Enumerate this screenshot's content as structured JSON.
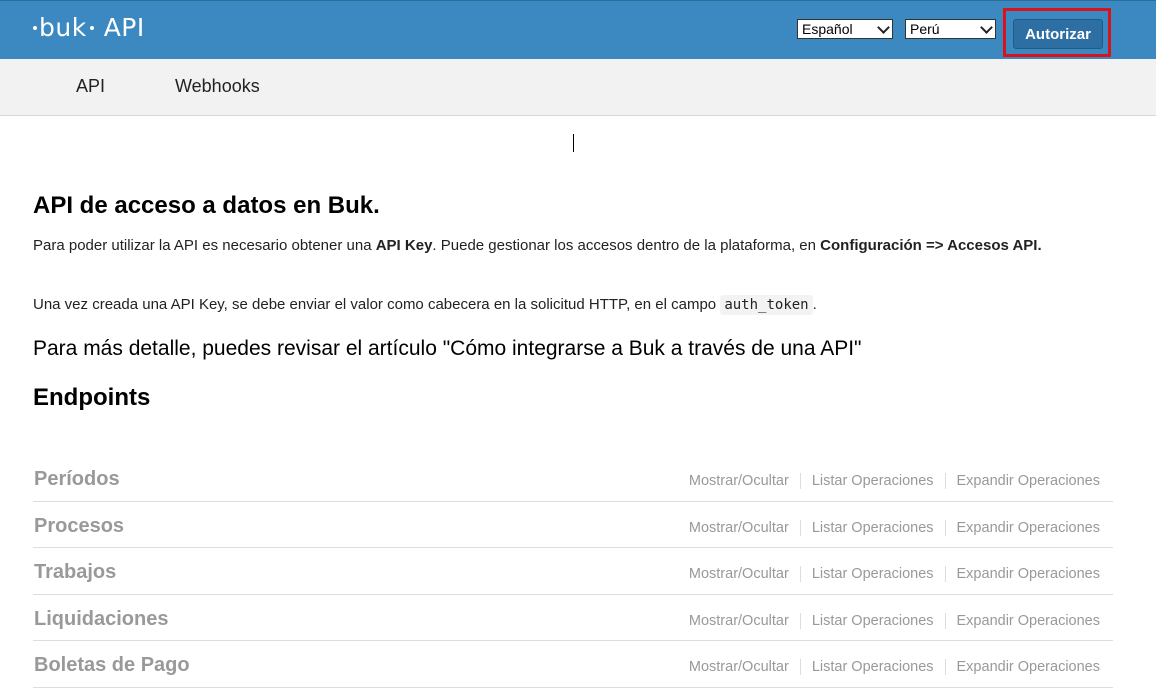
{
  "header": {
    "logo_text": "buk",
    "title": "API",
    "language_select": {
      "selected": "Español"
    },
    "country_select": {
      "selected": "Perú"
    },
    "authorize_label": "Autorizar",
    "highlight_color": "#d9131b",
    "bar_color": "#3b89c0"
  },
  "subnav": {
    "items": [
      {
        "label": "API"
      },
      {
        "label": "Webhooks"
      }
    ]
  },
  "intro": {
    "title": "API de acceso a datos en Buk.",
    "p1_part1": "Para poder utilizar la API es necesario obtener una ",
    "p1_bold1": "API Key",
    "p1_part2": ". Puede gestionar los accesos dentro de la plataforma, en ",
    "p1_bold2": "Configuración => Accesos API.",
    "p2_part1": "Una vez creada una API Key, se debe enviar el valor como cabecera en la solicitud HTTP, en el campo ",
    "p2_code": "auth_token",
    "p2_part2": ".",
    "more_link": "Para más detalle, puedes revisar el artículo \"Cómo integrarse a Buk a través de una API\""
  },
  "endpoints": {
    "title": "Endpoints",
    "actions": {
      "toggle": "Mostrar/Ocultar",
      "list": "Listar Operaciones",
      "expand": "Expandir Operaciones"
    },
    "resources": [
      {
        "name": "Períodos"
      },
      {
        "name": "Procesos"
      },
      {
        "name": "Trabajos"
      },
      {
        "name": "Liquidaciones"
      },
      {
        "name": "Boletas de Pago"
      }
    ]
  }
}
